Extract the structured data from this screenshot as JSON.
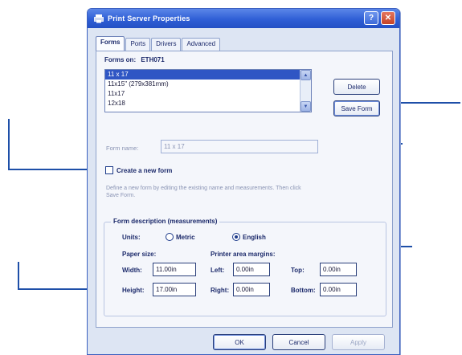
{
  "window": {
    "title": "Print Server Properties",
    "help_glyph": "?",
    "close_glyph": "✕"
  },
  "tabs": [
    {
      "label": "Forms",
      "active": true
    },
    {
      "label": "Ports",
      "active": false
    },
    {
      "label": "Drivers",
      "active": false
    },
    {
      "label": "Advanced",
      "active": false
    }
  ],
  "forms": {
    "forms_on_label": "Forms on:",
    "server_name": "ETH071",
    "list": [
      "11 x 17",
      "11x15\" (279x381mm)",
      "11x17",
      "12x18"
    ],
    "selected_index": 0,
    "delete_label": "Delete",
    "save_label": "Save Form",
    "form_name_label": "Form name:",
    "form_name_value": "11 x 17",
    "create_new_label": "Create a new form",
    "create_new_checked": false,
    "description": "Define a new form by editing the existing name and measurements. Then click Save Form."
  },
  "measurements": {
    "group_label": "Form description (measurements)",
    "units_label": "Units:",
    "metric_label": "Metric",
    "english_label": "English",
    "selected_unit": "English",
    "paper_size_label": "Paper size:",
    "printer_margins_label": "Printer area margins:",
    "width_label": "Width:",
    "width_value": "11.00in",
    "height_label": "Height:",
    "height_value": "17.00in",
    "left_label": "Left:",
    "left_value": "0.00in",
    "right_label": "Right:",
    "right_value": "0.00in",
    "top_label": "Top:",
    "top_value": "0.00in",
    "bottom_label": "Bottom:",
    "bottom_value": "0.00in"
  },
  "buttons": {
    "ok": "OK",
    "cancel": "Cancel",
    "apply": "Apply"
  },
  "colors": {
    "callout": "#1e4fa8",
    "titlebar": "#2f5fd6",
    "selection": "#2f56c4"
  }
}
